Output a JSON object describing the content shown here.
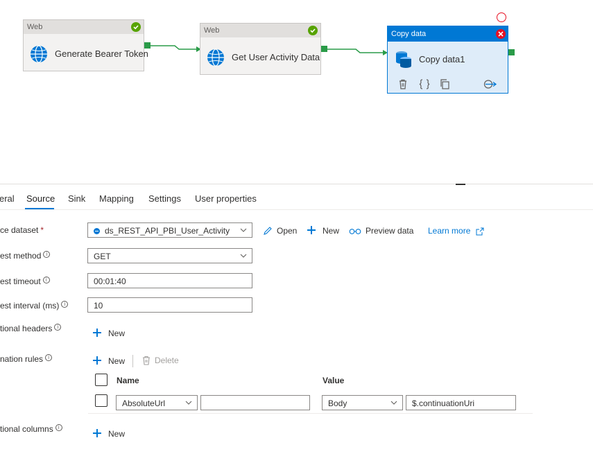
{
  "pipeline": {
    "activities": [
      {
        "type": "Web",
        "name": "Generate Bearer Token",
        "status": "succeeded"
      },
      {
        "type": "Web",
        "name": "Get User Activity Data",
        "status": "succeeded"
      }
    ],
    "copy_activity": {
      "type": "Copy data",
      "name": "Copy data1"
    }
  },
  "tabs": [
    "eral",
    "Source",
    "Sink",
    "Mapping",
    "Settings",
    "User properties"
  ],
  "active_tab": "Source",
  "source": {
    "dataset_label": "ce dataset",
    "dataset_required_mark": "*",
    "dataset_value": "ds_REST_API_PBI_User_Activity",
    "open_label": "Open",
    "new_label": "New",
    "preview_label": "Preview data",
    "learn_more_label": "Learn more",
    "request_method_label": "est method",
    "request_method_value": "GET",
    "request_timeout_label": "est timeout",
    "request_timeout_value": "00:01:40",
    "request_interval_label": "est interval (ms)",
    "request_interval_value": "10",
    "additional_headers_label": "tional headers",
    "additional_headers_new": "New",
    "pagination_label": "nation rules",
    "pagination_new": "New",
    "pagination_delete": "Delete",
    "pagination_columns": [
      "Name",
      "Value"
    ],
    "pagination_rows": [
      {
        "name": "AbsoluteUrl",
        "name_extra": "",
        "value_type": "Body",
        "value": "$.continuationUri"
      }
    ],
    "additional_columns_label": "tional columns",
    "additional_columns_new": "New"
  },
  "icons": {
    "info": "info-icon",
    "web": "globe-icon",
    "copy": "database-icon"
  },
  "colors": {
    "accent": "#0078d4",
    "success": "#57a300",
    "error": "#e81123",
    "port": "#2a9b48"
  }
}
